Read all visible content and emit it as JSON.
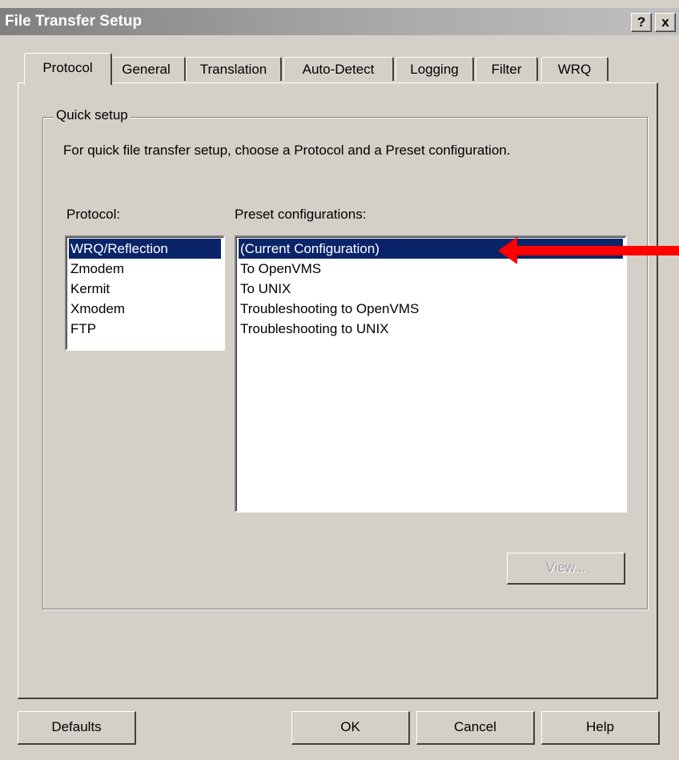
{
  "window": {
    "title": "File Transfer Setup",
    "help_btn": "?",
    "close_btn": "x"
  },
  "tabs": [
    {
      "label": "Protocol",
      "active": true
    },
    {
      "label": "General"
    },
    {
      "label": "Translation"
    },
    {
      "label": "Auto-Detect"
    },
    {
      "label": "Logging"
    },
    {
      "label": "Filter"
    },
    {
      "label": "WRQ"
    }
  ],
  "quick_setup": {
    "legend": "Quick setup",
    "description": "For quick file transfer setup, choose a Protocol and a Preset configuration.",
    "protocol_label": "Protocol:",
    "protocols": [
      "WRQ/Reflection",
      "Zmodem",
      "Kermit",
      "Xmodem",
      "FTP"
    ],
    "protocol_selected": "WRQ/Reflection",
    "presets_label": "Preset configurations:",
    "presets": [
      "(Current Configuration)",
      "To OpenVMS",
      "To UNIX",
      "Troubleshooting to OpenVMS",
      "Troubleshooting to UNIX"
    ],
    "preset_selected": "(Current Configuration)",
    "view_button": "View..."
  },
  "buttons": {
    "defaults": "Defaults",
    "ok": "OK",
    "cancel": "Cancel",
    "help": "Help"
  },
  "colors": {
    "selection": "#0a246a",
    "annotation_arrow": "#ff0000",
    "face": "#d4d0c8"
  }
}
